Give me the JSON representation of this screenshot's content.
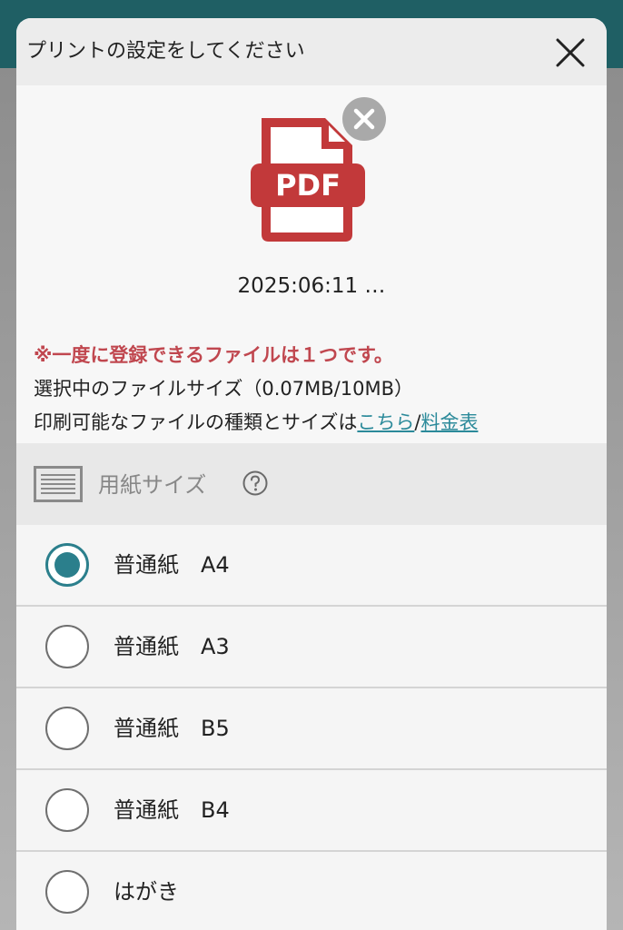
{
  "modal": {
    "title": "プリントの設定をしてください"
  },
  "file": {
    "type_label": "PDF",
    "name": "2025:06:11 …",
    "brand_color": "#c2393a"
  },
  "notice": "※一度に登録できるファイルは１つです。",
  "file_size_text": "選択中のファイルサイズ（0.07MB/10MB）",
  "info": {
    "prefix": "印刷可能なファイルの種類とサイズは",
    "link1": "こちら",
    "separator": "/",
    "link2": "料金表"
  },
  "paper_section": {
    "title": "用紙サイズ",
    "options": [
      {
        "label": "普通紙　A4",
        "selected": true
      },
      {
        "label": "普通紙　A3",
        "selected": false
      },
      {
        "label": "普通紙　B5",
        "selected": false
      },
      {
        "label": "普通紙　B4",
        "selected": false
      },
      {
        "label": "はがき",
        "selected": false
      }
    ]
  },
  "colors": {
    "accent": "#2b7f8c",
    "link": "#2b8a9a",
    "warning": "#c0474f",
    "app_header": "#1f5f64"
  }
}
